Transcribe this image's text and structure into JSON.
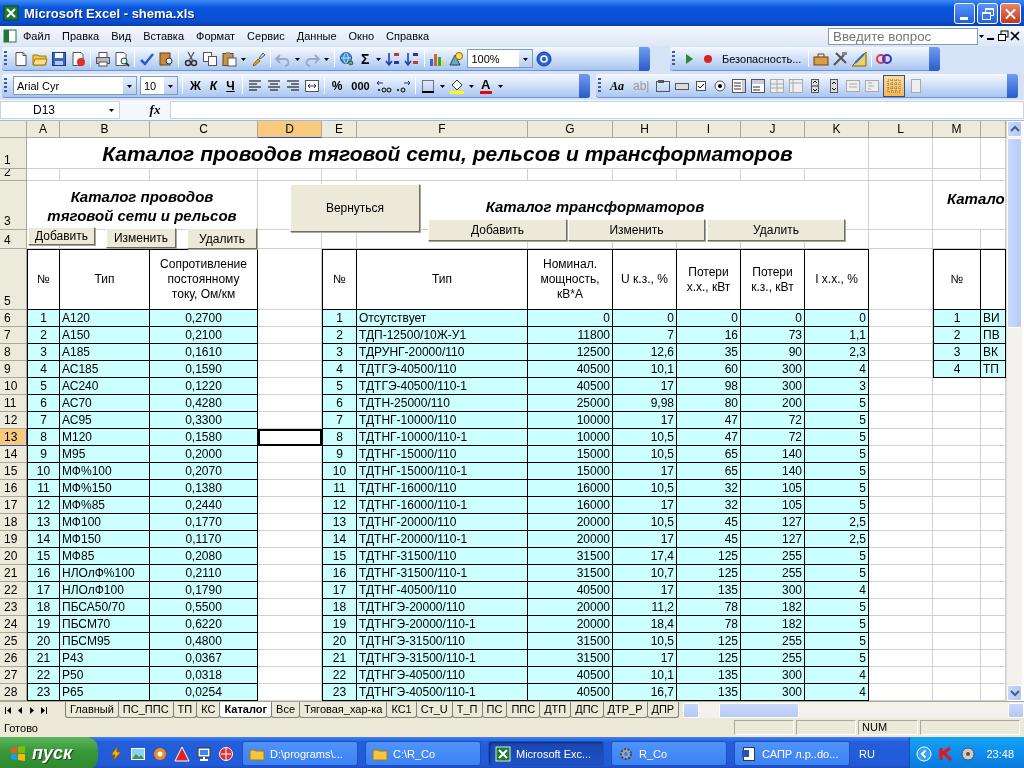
{
  "window": {
    "title": "Microsoft Excel - shema.xls"
  },
  "menu": {
    "items": [
      "Файл",
      "Правка",
      "Вид",
      "Вставка",
      "Формат",
      "Сервис",
      "Данные",
      "Окно",
      "Справка"
    ],
    "help_placeholder": "Введите вопрос"
  },
  "toolbars": {
    "sum_label": "Σ",
    "zoom": "100%",
    "security": "Безопасность...",
    "font": "Arial Cyr",
    "size": "10",
    "format_buttons": [
      {
        "kind": "bold",
        "label": "Ж"
      },
      {
        "kind": "italic",
        "label": "К"
      },
      {
        "kind": "underline",
        "label": "Ч"
      }
    ],
    "percent": "%",
    "thousands": "000",
    "font_color_label": "A",
    "forms_label": "Aa",
    "forms_edit": "ab|",
    "grid_toggle_on": true
  },
  "formula_bar": {
    "name_box": "D13",
    "fx_label": "fx"
  },
  "sheet": {
    "columns": [
      {
        "label": "A",
        "selected": false
      },
      {
        "label": "B",
        "selected": false
      },
      {
        "label": "C",
        "selected": false
      },
      {
        "label": "D",
        "selected": true
      },
      {
        "label": "E",
        "selected": false
      },
      {
        "label": "F",
        "selected": false
      },
      {
        "label": "G",
        "selected": false
      },
      {
        "label": "H",
        "selected": false
      },
      {
        "label": "I",
        "selected": false
      },
      {
        "label": "J",
        "selected": false
      },
      {
        "label": "K",
        "selected": false
      },
      {
        "label": "L",
        "selected": false
      },
      {
        "label": "M",
        "selected": false
      }
    ],
    "rows": [
      {
        "label": "1",
        "selected": false
      },
      {
        "label": "2",
        "selected": false
      },
      {
        "label": "3",
        "selected": false
      },
      {
        "label": "4",
        "selected": false
      },
      {
        "label": "5",
        "selected": false
      },
      {
        "label": "6",
        "selected": false
      },
      {
        "label": "7",
        "selected": false
      },
      {
        "label": "8",
        "selected": false
      },
      {
        "label": "9",
        "selected": false
      },
      {
        "label": "10",
        "selected": false
      },
      {
        "label": "11",
        "selected": false
      },
      {
        "label": "12",
        "selected": false
      },
      {
        "label": "13",
        "selected": true
      },
      {
        "label": "14",
        "selected": false
      },
      {
        "label": "15",
        "selected": false
      },
      {
        "label": "16",
        "selected": false
      },
      {
        "label": "17",
        "selected": false
      },
      {
        "label": "18",
        "selected": false
      },
      {
        "label": "19",
        "selected": false
      },
      {
        "label": "20",
        "selected": false
      },
      {
        "label": "21",
        "selected": false
      },
      {
        "label": "22",
        "selected": false
      },
      {
        "label": "23",
        "selected": false
      },
      {
        "label": "24",
        "selected": false
      },
      {
        "label": "25",
        "selected": false
      },
      {
        "label": "26",
        "selected": false
      },
      {
        "label": "27",
        "selected": false
      },
      {
        "label": "28",
        "selected": false
      }
    ],
    "title": "Каталог проводов тяговой сети, рельсов и трансформаторов",
    "return_button": "Вернуться",
    "wire_catalog": {
      "title": "Каталог проводов тяговой сети и рельсов",
      "buttons": [
        "Добавить",
        "Изменить",
        "Удалить"
      ],
      "columns": [
        "№",
        "Тип",
        "Сопротивление постоянному току, Ом/км"
      ],
      "rows": [
        {
          "n": "1",
          "type": "А120",
          "resistance": "0,2700"
        },
        {
          "n": "2",
          "type": "А150",
          "resistance": "0,2100"
        },
        {
          "n": "3",
          "type": "А185",
          "resistance": "0,1610"
        },
        {
          "n": "4",
          "type": "АС185",
          "resistance": "0,1590"
        },
        {
          "n": "5",
          "type": "АС240",
          "resistance": "0,1220"
        },
        {
          "n": "6",
          "type": "АС70",
          "resistance": "0,4280"
        },
        {
          "n": "7",
          "type": "АС95",
          "resistance": "0,3300"
        },
        {
          "n": "8",
          "type": "М120",
          "resistance": "0,1580"
        },
        {
          "n": "9",
          "type": "М95",
          "resistance": "0,2000"
        },
        {
          "n": "10",
          "type": "МФ%100",
          "resistance": "0,2070"
        },
        {
          "n": "11",
          "type": "МФ%150",
          "resistance": "0,1380"
        },
        {
          "n": "12",
          "type": "МФ%85",
          "resistance": "0,2440"
        },
        {
          "n": "13",
          "type": "МФ100",
          "resistance": "0,1770"
        },
        {
          "n": "14",
          "type": "МФ150",
          "resistance": "0,1170"
        },
        {
          "n": "15",
          "type": "МФ85",
          "resistance": "0,2080"
        },
        {
          "n": "16",
          "type": "НЛОлФ%100",
          "resistance": "0,2110"
        },
        {
          "n": "17",
          "type": "НЛОлФ100",
          "resistance": "0,1790"
        },
        {
          "n": "18",
          "type": "ПБСА50/70",
          "resistance": "0,5500"
        },
        {
          "n": "19",
          "type": "ПБСМ70",
          "resistance": "0,6220"
        },
        {
          "n": "20",
          "type": "ПБСМ95",
          "resistance": "0,4800"
        },
        {
          "n": "21",
          "type": "Р43",
          "resistance": "0,0367"
        },
        {
          "n": "22",
          "type": "Р50",
          "resistance": "0,0318"
        },
        {
          "n": "23",
          "type": "Р65",
          "resistance": "0,0254"
        }
      ]
    },
    "transformer_catalog": {
      "title": "Каталог трансформаторов",
      "buttons": [
        "Добавить",
        "Изменить",
        "Удалить"
      ],
      "columns": [
        "№",
        "Тип",
        "Номинал. мощность, кВ*А",
        "U к.з., %",
        "Потери х.х., кВт",
        "Потери к.з., кВт",
        "I х.х., %"
      ],
      "rows": [
        {
          "n": "1",
          "type": "Отсутствует",
          "power": "0",
          "uk": "0",
          "p_nl": "0",
          "p_sc": "0",
          "i_nl": "0"
        },
        {
          "n": "2",
          "type": "ТДП-12500/10Ж-У1",
          "power": "11800",
          "uk": "7",
          "p_nl": "16",
          "p_sc": "73",
          "i_nl": "1,1"
        },
        {
          "n": "3",
          "type": "ТДРУНГ-20000/110",
          "power": "12500",
          "uk": "12,6",
          "p_nl": "35",
          "p_sc": "90",
          "i_nl": "2,3"
        },
        {
          "n": "4",
          "type": "ТДТГЭ-40500/110",
          "power": "40500",
          "uk": "10,1",
          "p_nl": "60",
          "p_sc": "300",
          "i_nl": "4"
        },
        {
          "n": "5",
          "type": "ТДТГЭ-40500/110-1",
          "power": "40500",
          "uk": "17",
          "p_nl": "98",
          "p_sc": "300",
          "i_nl": "3"
        },
        {
          "n": "6",
          "type": "ТДТН-25000/110",
          "power": "25000",
          "uk": "9,98",
          "p_nl": "80",
          "p_sc": "200",
          "i_nl": "5"
        },
        {
          "n": "7",
          "type": "ТДТНГ-10000/110",
          "power": "10000",
          "uk": "17",
          "p_nl": "47",
          "p_sc": "72",
          "i_nl": "5"
        },
        {
          "n": "8",
          "type": "ТДТНГ-10000/110-1",
          "power": "10000",
          "uk": "10,5",
          "p_nl": "47",
          "p_sc": "72",
          "i_nl": "5"
        },
        {
          "n": "9",
          "type": "ТДТНГ-15000/110",
          "power": "15000",
          "uk": "10,5",
          "p_nl": "65",
          "p_sc": "140",
          "i_nl": "5"
        },
        {
          "n": "10",
          "type": "ТДТНГ-15000/110-1",
          "power": "15000",
          "uk": "17",
          "p_nl": "65",
          "p_sc": "140",
          "i_nl": "5"
        },
        {
          "n": "11",
          "type": "ТДТНГ-16000/110",
          "power": "16000",
          "uk": "10,5",
          "p_nl": "32",
          "p_sc": "105",
          "i_nl": "5"
        },
        {
          "n": "12",
          "type": "ТДТНГ-16000/110-1",
          "power": "16000",
          "uk": "17",
          "p_nl": "32",
          "p_sc": "105",
          "i_nl": "5"
        },
        {
          "n": "13",
          "type": "ТДТНГ-20000/110",
          "power": "20000",
          "uk": "10,5",
          "p_nl": "45",
          "p_sc": "127",
          "i_nl": "2,5"
        },
        {
          "n": "14",
          "type": "ТДТНГ-20000/110-1",
          "power": "20000",
          "uk": "17",
          "p_nl": "45",
          "p_sc": "127",
          "i_nl": "2,5"
        },
        {
          "n": "15",
          "type": "ТДТНГ-31500/110",
          "power": "31500",
          "uk": "17,4",
          "p_nl": "125",
          "p_sc": "255",
          "i_nl": "5"
        },
        {
          "n": "16",
          "type": "ТДТНГ-31500/110-1",
          "power": "31500",
          "uk": "10,7",
          "p_nl": "125",
          "p_sc": "255",
          "i_nl": "5"
        },
        {
          "n": "17",
          "type": "ТДТНГ-40500/110",
          "power": "40500",
          "uk": "17",
          "p_nl": "135",
          "p_sc": "300",
          "i_nl": "4"
        },
        {
          "n": "18",
          "type": "ТДТНГЭ-20000/110",
          "power": "20000",
          "uk": "11,2",
          "p_nl": "78",
          "p_sc": "182",
          "i_nl": "5"
        },
        {
          "n": "19",
          "type": "ТДТНГЭ-20000/110-1",
          "power": "20000",
          "uk": "18,4",
          "p_nl": "78",
          "p_sc": "182",
          "i_nl": "5"
        },
        {
          "n": "20",
          "type": "ТДТНГЭ-31500/110",
          "power": "31500",
          "uk": "10,5",
          "p_nl": "125",
          "p_sc": "255",
          "i_nl": "5"
        },
        {
          "n": "21",
          "type": "ТДТНГЭ-31500/110-1",
          "power": "31500",
          "uk": "17",
          "p_nl": "125",
          "p_sc": "255",
          "i_nl": "5"
        },
        {
          "n": "22",
          "type": "ТДТНГЭ-40500/110",
          "power": "40500",
          "uk": "10,1",
          "p_nl": "135",
          "p_sc": "300",
          "i_nl": "4"
        },
        {
          "n": "23",
          "type": "ТДТНГЭ-40500/110-1",
          "power": "40500",
          "uk": "16,7",
          "p_nl": "135",
          "p_sc": "300",
          "i_nl": "4"
        }
      ]
    },
    "third_catalog": {
      "title": "Катало",
      "columns": [
        "№"
      ],
      "rows": [
        {
          "n": "1",
          "type": "ВИ"
        },
        {
          "n": "2",
          "type": "ПВ"
        },
        {
          "n": "3",
          "type": "ВК"
        },
        {
          "n": "4",
          "type": "ТП"
        }
      ]
    }
  },
  "sheet_tabs": [
    {
      "label": "Главный",
      "selected": false
    },
    {
      "label": "ПС_ППС",
      "selected": false
    },
    {
      "label": "ТП",
      "selected": false
    },
    {
      "label": "КС",
      "selected": false
    },
    {
      "label": "Каталог",
      "selected": true
    },
    {
      "label": "Все",
      "selected": false
    },
    {
      "label": "Тяговая_хар-ка",
      "selected": false
    },
    {
      "label": "КС1",
      "selected": false
    },
    {
      "label": "Ст_U",
      "selected": false
    },
    {
      "label": "Т_П",
      "selected": false
    },
    {
      "label": "ПС",
      "selected": false
    },
    {
      "label": "ППС",
      "selected": false
    },
    {
      "label": "ДТП",
      "selected": false
    },
    {
      "label": "ДПС",
      "selected": false
    },
    {
      "label": "ДТР_Р",
      "selected": false
    },
    {
      "label": "ДПР",
      "selected": false
    }
  ],
  "status_bar": {
    "text": "Готово",
    "num": "NUM"
  },
  "taskbar": {
    "start": "пуск",
    "tasks": [
      {
        "kind": "folder",
        "label": "D:\\programs\\...",
        "selected": false
      },
      {
        "kind": "folder",
        "label": "C:\\R_Co",
        "selected": false
      },
      {
        "kind": "excel",
        "label": "Microsoft Exc...",
        "selected": true
      },
      {
        "kind": "gear",
        "label": "R_Co",
        "selected": false
      },
      {
        "kind": "document",
        "label": "САПР л.р..do...",
        "selected": false
      }
    ],
    "language": "RU",
    "time": "23:48"
  }
}
